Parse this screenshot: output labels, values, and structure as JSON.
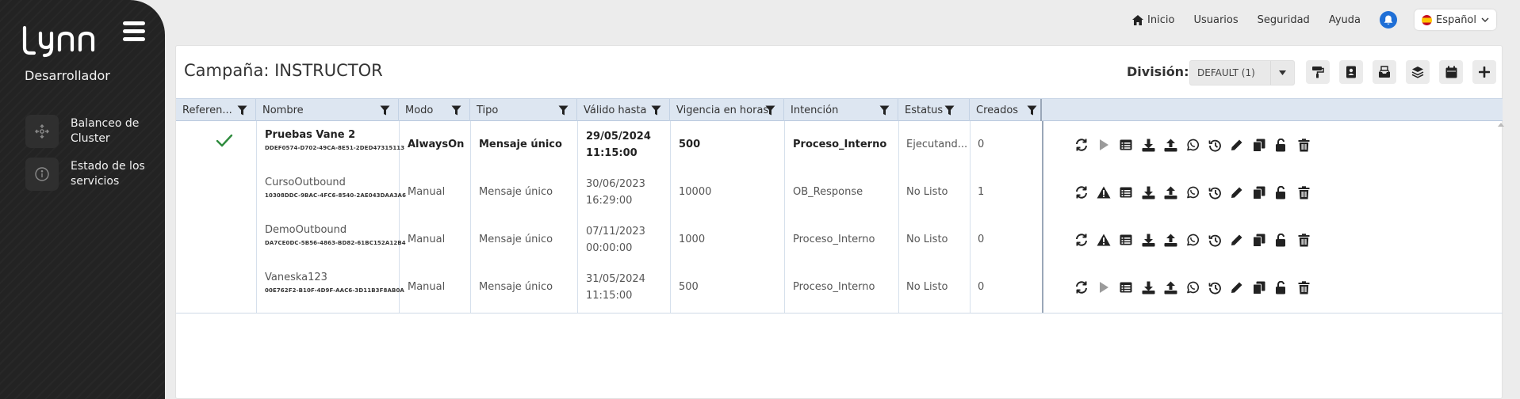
{
  "sidebar": {
    "role": "Desarrollador",
    "items": [
      {
        "label": "Balanceo de Cluster",
        "icon": "cluster-icon"
      },
      {
        "label": "Estado de los servicios",
        "icon": "info-icon"
      }
    ]
  },
  "nav": {
    "home": "Inicio",
    "users": "Usuarios",
    "security": "Seguridad",
    "help": "Ayuda",
    "language": "Español"
  },
  "page": {
    "title": "Campaña: INSTRUCTOR",
    "division_label": "División:",
    "division_value": "DEFAULT (1)"
  },
  "table": {
    "columns": [
      "Referen...",
      "Nombre",
      "Modo",
      "Tipo",
      "Válido hasta",
      "Vigencia en horas",
      "Intención",
      "Estatus",
      "Creados"
    ],
    "rows": [
      {
        "name": "Pruebas Vane 2",
        "id": "DDEF0574-D702-49CA-8E51-2DED47315113",
        "mode": "AlwaysOn",
        "type": "Mensaje único",
        "valid_date": "29/05/2024",
        "valid_time": "11:15:00",
        "hours": "500",
        "intent": "Proceso_Interno",
        "status": "Ejecutand...",
        "created": "0",
        "bold": true,
        "referenced": true,
        "state": "play"
      },
      {
        "name": "CursoOutbound",
        "id": "10308DDC-9BAC-4FC6-8540-2AE043DAA3A6",
        "mode": "Manual",
        "type": "Mensaje único",
        "valid_date": "30/06/2023",
        "valid_time": "16:29:00",
        "hours": "10000",
        "intent": "OB_Response",
        "status": "No Listo",
        "created": "1",
        "bold": false,
        "referenced": false,
        "state": "warning"
      },
      {
        "name": "DemoOutbound",
        "id": "DA7CE0DC-5B56-4863-BD82-61BC152A12B4",
        "mode": "Manual",
        "type": "Mensaje único",
        "valid_date": "07/11/2023",
        "valid_time": "00:00:00",
        "hours": "1000",
        "intent": "Proceso_Interno",
        "status": "No Listo",
        "created": "0",
        "bold": false,
        "referenced": false,
        "state": "warning"
      },
      {
        "name": "Vaneska123",
        "id": "00E762F2-B10F-4D9F-AAC6-3D11B3F8AB0A",
        "mode": "Manual",
        "type": "Mensaje único",
        "valid_date": "31/05/2024",
        "valid_time": "11:15:00",
        "hours": "500",
        "intent": "Proceso_Interno",
        "status": "No Listo",
        "created": "0",
        "bold": false,
        "referenced": false,
        "state": "play"
      }
    ]
  },
  "colors": {
    "sidebar": "#232323",
    "accent": "#1f6fd6",
    "header": "#dde6f1",
    "check": "#2e8b3d"
  }
}
